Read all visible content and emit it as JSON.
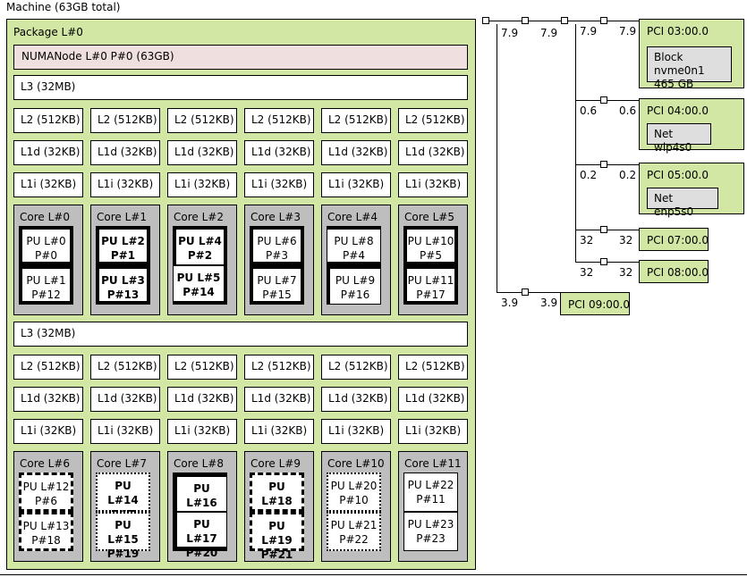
{
  "machine": {
    "title": "Machine (63GB total)"
  },
  "package": {
    "label": "Package L#0",
    "numa": "NUMANode L#0 P#0 (63GB)",
    "groups": [
      {
        "l3": "L3 (32MB)",
        "l2": [
          "L2 (512KB)",
          "L2 (512KB)",
          "L2 (512KB)",
          "L2 (512KB)",
          "L2 (512KB)",
          "L2 (512KB)"
        ],
        "l1d": [
          "L1d (32KB)",
          "L1d (32KB)",
          "L1d (32KB)",
          "L1d (32KB)",
          "L1d (32KB)",
          "L1d (32KB)"
        ],
        "l1i": [
          "L1i (32KB)",
          "L1i (32KB)",
          "L1i (32KB)",
          "L1i (32KB)",
          "L1i (32KB)",
          "L1i (32KB)"
        ],
        "cores": [
          {
            "label": "Core L#0",
            "pus": [
              "PU L#0\nP#0",
              "PU L#1\nP#12"
            ]
          },
          {
            "label": "Core L#1",
            "pus": [
              "PU L#2\nP#1",
              "PU L#3\nP#13"
            ]
          },
          {
            "label": "Core L#2",
            "pus": [
              "PU L#4\nP#2",
              "PU L#5\nP#14"
            ]
          },
          {
            "label": "Core L#3",
            "pus": [
              "PU L#6\nP#3",
              "PU L#7\nP#15"
            ]
          },
          {
            "label": "Core L#4",
            "pus": [
              "PU L#8\nP#4",
              "PU L#9\nP#16"
            ]
          },
          {
            "label": "Core L#5",
            "pus": [
              "PU L#10\nP#5",
              "PU L#11\nP#17"
            ]
          }
        ]
      },
      {
        "l3": "L3 (32MB)",
        "l2": [
          "L2 (512KB)",
          "L2 (512KB)",
          "L2 (512KB)",
          "L2 (512KB)",
          "L2 (512KB)",
          "L2 (512KB)"
        ],
        "l1d": [
          "L1d (32KB)",
          "L1d (32KB)",
          "L1d (32KB)",
          "L1d (32KB)",
          "L1d (32KB)",
          "L1d (32KB)"
        ],
        "l1i": [
          "L1i (32KB)",
          "L1i (32KB)",
          "L1i (32KB)",
          "L1i (32KB)",
          "L1i (32KB)",
          "L1i (32KB)"
        ],
        "cores": [
          {
            "label": "Core L#6",
            "pus": [
              "PU L#12\nP#6",
              "PU L#13\nP#18"
            ]
          },
          {
            "label": "Core L#7",
            "pus": [
              "PU L#14\nP#7",
              "PU L#15\nP#19"
            ]
          },
          {
            "label": "Core L#8",
            "pus": [
              "PU L#16\nP#8",
              "PU L#17\nP#20"
            ]
          },
          {
            "label": "Core L#9",
            "pus": [
              "PU L#18\nP#9",
              "PU L#19\nP#21"
            ]
          },
          {
            "label": "Core L#10",
            "pus": [
              "PU L#20\nP#10",
              "PU L#21\nP#22"
            ]
          },
          {
            "label": "Core L#11",
            "pus": [
              "PU L#22\nP#11",
              "PU L#23\nP#23"
            ]
          }
        ]
      }
    ]
  },
  "pci": [
    {
      "label": "PCI 03:00.0",
      "device": "Block nvme0n1\n465 GB",
      "bw_left": "7.9",
      "bw_right": "7.9"
    },
    {
      "label": "PCI 04:00.0",
      "device": "Net wlp4s0",
      "bw_left": "0.6",
      "bw_right": "0.6"
    },
    {
      "label": "PCI 05:00.0",
      "device": "Net enp5s0",
      "bw_left": "0.2",
      "bw_right": "0.2"
    },
    {
      "label": "PCI 07:00.0",
      "device": "",
      "bw_left": "32",
      "bw_right": "32"
    },
    {
      "label": "PCI 08:00.0",
      "device": "",
      "bw_left": "32",
      "bw_right": "32"
    },
    {
      "label": "PCI 09:00.0",
      "device": "",
      "bw_left": "3.9",
      "bw_right": "3.9"
    }
  ],
  "bridge_bw": {
    "host_left": "7.9",
    "host_right": "7.9"
  },
  "colors": {
    "package": "#d2e7a4",
    "numa": "#efdfde",
    "core": "#bebebe",
    "pu": "#ffffff",
    "osdev": "#dedede"
  }
}
